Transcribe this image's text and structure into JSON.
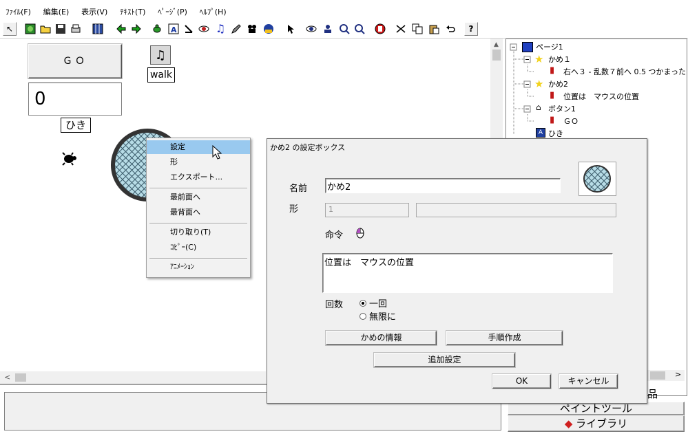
{
  "menu": [
    "ﾌｧｲﾙ(F)",
    "編集(E)",
    "表示(V)",
    "ﾃｷｽﾄ(T)",
    "ﾍﾟｰｼﾞ(P)",
    "ﾍﾙﾌﾟ(H)"
  ],
  "toolbar": {
    "icons": [
      "arrow-pointer-icon",
      "globe-icon",
      "open-folder-icon",
      "save-icon",
      "print-icon",
      "grid-icon",
      "arrow-left-icon",
      "arrow-right-icon",
      "turtle-tool-icon",
      "text-a-icon",
      "stamp-icon",
      "eye-tool-icon",
      "music-note-icon",
      "pen-tool-icon",
      "movie-icon",
      "record-icon",
      "cursor-icon",
      "eye-icon",
      "person-icon",
      "zoom-in-icon",
      "zoom-out-icon",
      "stop-hand-icon",
      "cut-icon",
      "copy-icon",
      "paste-icon",
      "undo-icon",
      "help-icon"
    ],
    "help_label": "?"
  },
  "canvas": {
    "go_button": "ＧＯ",
    "counter_value": "0",
    "counter_label": "ひき",
    "walk_label": "walk"
  },
  "context_menu": {
    "items": [
      "設定",
      "形",
      "エクスポート...",
      "最前面へ",
      "最背面へ",
      "切り取り(T)",
      "ｺﾋﾟｰ(C)",
      "ｱﾆﾒｰｼｮﾝ"
    ]
  },
  "tree": {
    "nodes": [
      "ページ1",
      "かめ１",
      "右へ３ - 乱数７前へ 0.5 つかまった",
      "かめ2",
      "位置は　マウスの位置",
      "ボタン1",
      "ＧＯ",
      "ひき"
    ]
  },
  "dialog": {
    "title": "かめ2 の設定ボックス",
    "name_label": "名前",
    "name_value": "かめ2",
    "shape_label": "形",
    "shape_value": "1",
    "command_label": "命令",
    "command_text": "位置は　マウスの位置",
    "count_label": "回数",
    "radio_once": "一回",
    "radio_infinite": "無限に",
    "radio_selected": "一回",
    "btn_info": "かめの情報",
    "btn_procedure": "手順作成",
    "btn_extra": "追加設定",
    "btn_ok": "OK",
    "btn_cancel": "キャンセル"
  },
  "bottom_tabs": [
    "ペイントツール",
    "ライブラリ"
  ],
  "partial_tab": "品",
  "colors": {
    "menu_highlight": "#99c9ef",
    "tree_star": "#f2d21a",
    "turtle_net": "#b7dce6"
  }
}
